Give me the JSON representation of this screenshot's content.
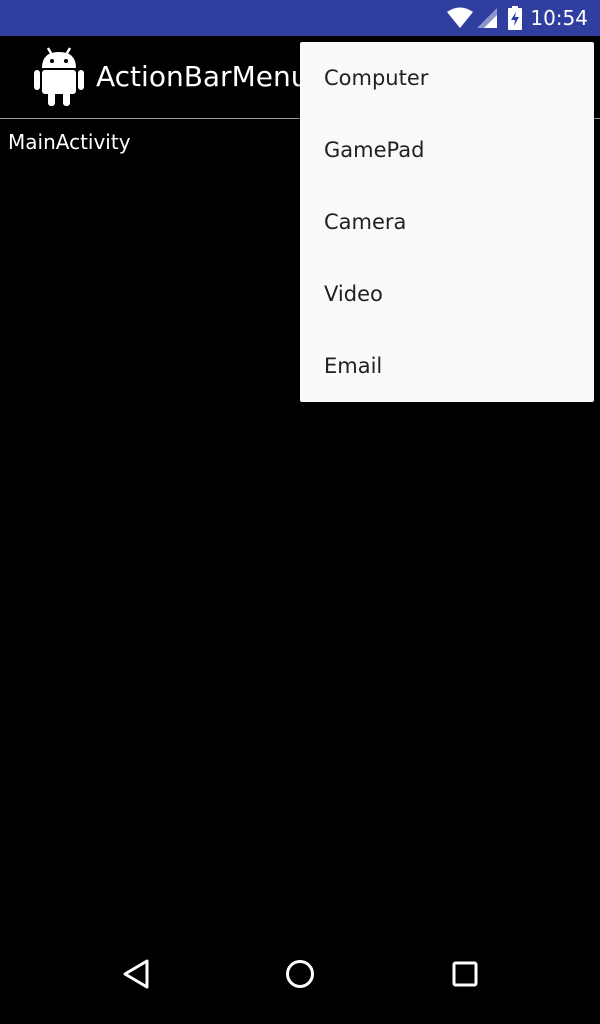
{
  "status_bar": {
    "time": "10:54",
    "background": "#303F9F",
    "icons": [
      "wifi-icon",
      "cell-signal-icon",
      "battery-charging-icon"
    ]
  },
  "action_bar": {
    "title": "ActionBarMenu",
    "icon": "android-robot-icon"
  },
  "main": {
    "text": "MainActivity"
  },
  "overflow_menu": {
    "items": [
      {
        "label": "Computer"
      },
      {
        "label": "GamePad"
      },
      {
        "label": "Camera"
      },
      {
        "label": "Video"
      },
      {
        "label": "Email"
      }
    ],
    "background": "#FAFAFA"
  },
  "nav_bar": {
    "buttons": [
      "back-icon",
      "home-icon",
      "recents-icon"
    ]
  }
}
